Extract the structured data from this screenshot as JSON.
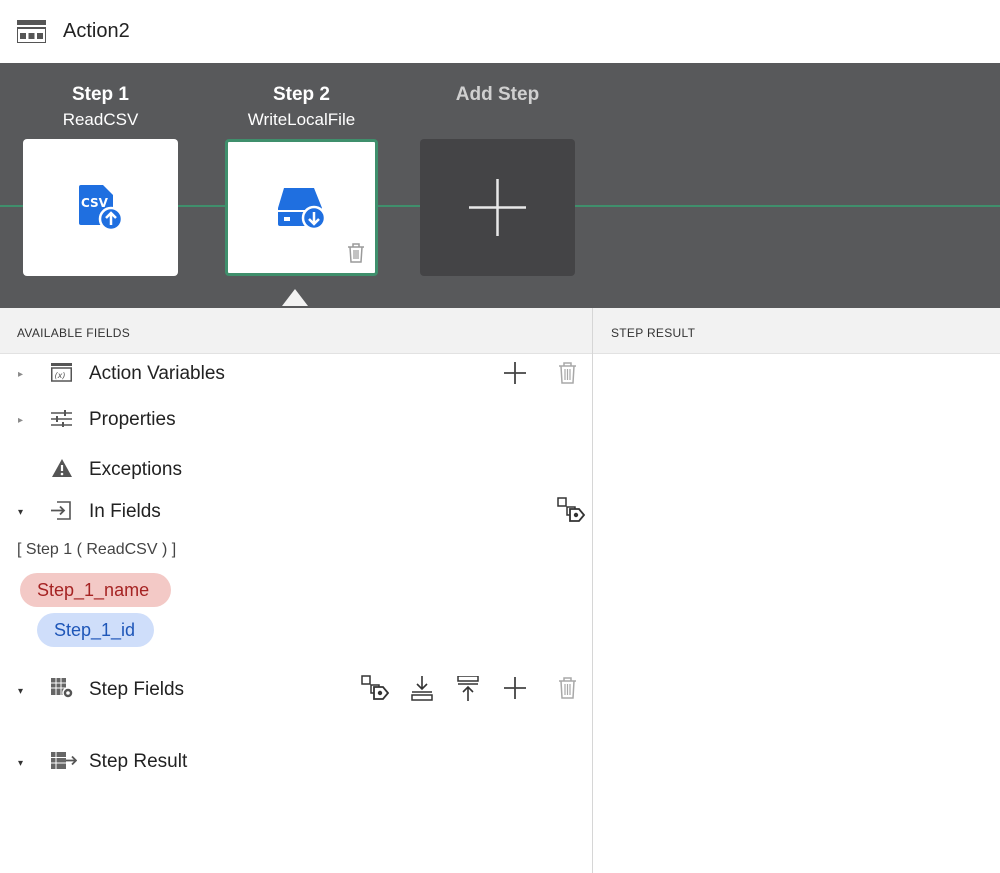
{
  "window": {
    "title": "Action2"
  },
  "steps": [
    {
      "number_label": "Step 1",
      "name": "ReadCSV",
      "icon": "csv-upload-icon",
      "selected": false
    },
    {
      "number_label": "Step 2",
      "name": "WriteLocalFile",
      "icon": "drive-download-icon",
      "selected": true
    }
  ],
  "add_step": {
    "label": "Add Step"
  },
  "colors": {
    "band": "#58595b",
    "accent_green": "#3f8f6c",
    "icon_blue": "#1f6fe0",
    "pill_red_bg": "#f3c9c6",
    "pill_blue_bg": "#cfdefa"
  },
  "panels": {
    "available_fields_header": "AVAILABLE FIELDS",
    "step_result_header": "STEP RESULT"
  },
  "tree": {
    "action_variables": "Action Variables",
    "properties": "Properties",
    "exceptions": "Exceptions",
    "in_fields": "In Fields",
    "in_fields_source": "[ Step 1 ( ReadCSV ) ]",
    "fields": [
      "Step_1_name",
      "Step_1_id"
    ],
    "step_fields": "Step Fields",
    "step_result": "Step Result"
  }
}
